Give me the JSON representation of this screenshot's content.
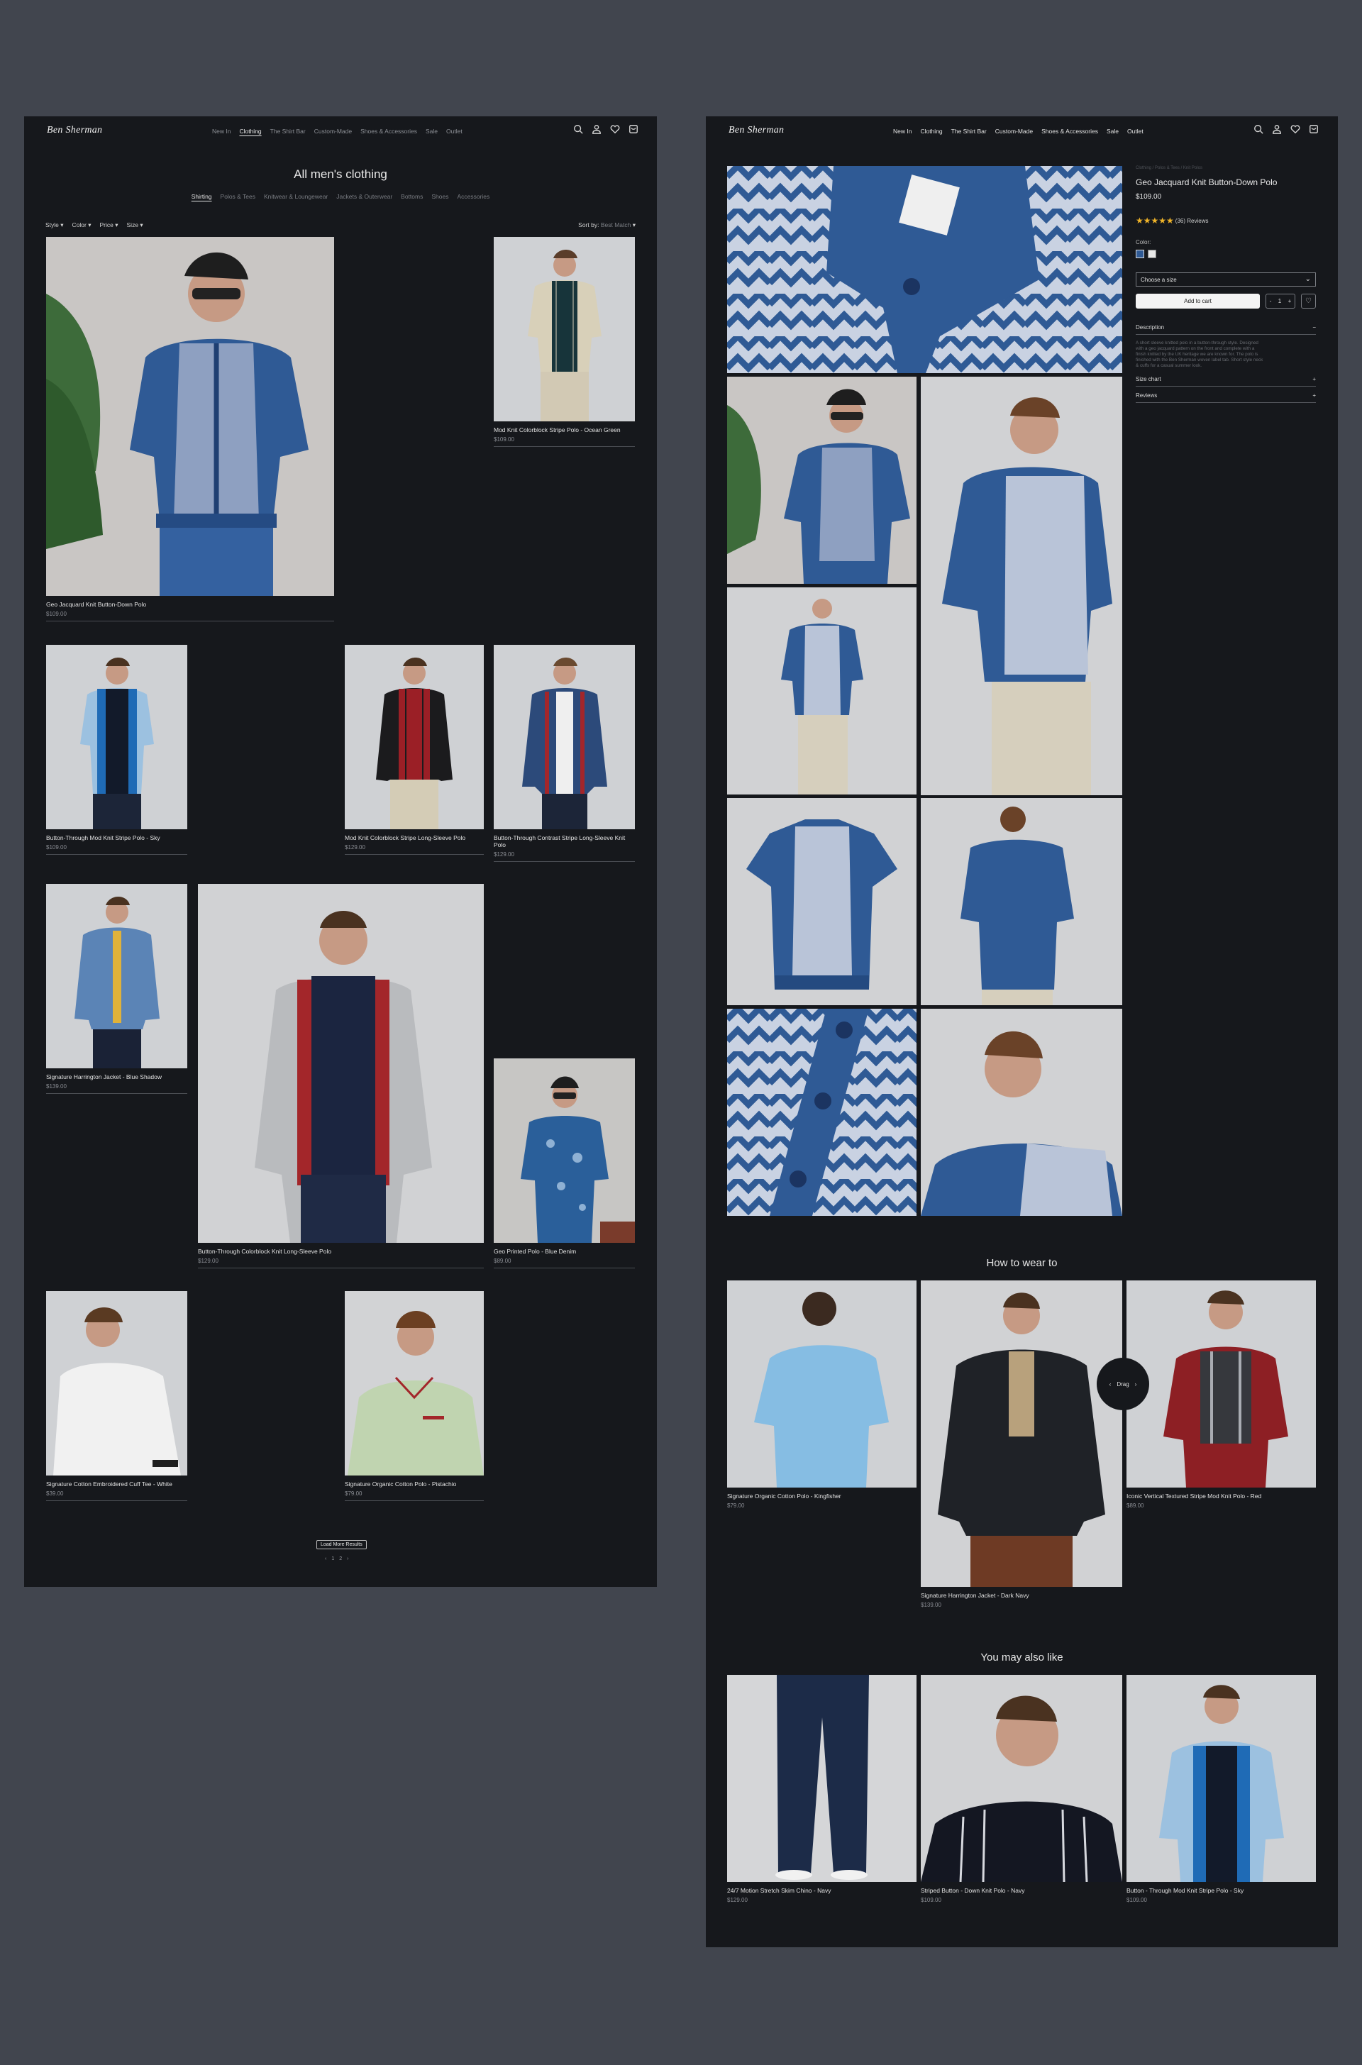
{
  "listing": {
    "logo": "Ben Sherman",
    "nav": [
      "New In",
      "Clothing",
      "The Shirt Bar",
      "Custom-Made",
      "Shoes & Accessories",
      "Sale",
      "Outlet"
    ],
    "title": "All men's clothing",
    "categories": [
      "Shirting",
      "Polos & Tees",
      "Knitwear & Loungewear",
      "Jackets & Outerwear",
      "Bottoms",
      "Shoes",
      "Accessories"
    ],
    "filters": [
      "Style",
      "Color",
      "Price",
      "Size"
    ],
    "sort_label": "Sort by:",
    "sort_value": "Best Match",
    "products": [
      {
        "name": "Geo Jacquard Knit Button-Down Polo",
        "price": "$109.00"
      },
      {
        "name": "Mod Knit Colorblock Stripe Polo - Ocean Green",
        "price": "$109.00"
      },
      {
        "name": "Button-Through Mod Knit Stripe Polo - Sky",
        "price": "$109.00"
      },
      {
        "name": "Mod Knit Colorblock Stripe Long-Sleeve Polo",
        "price": "$129.00"
      },
      {
        "name": "Button-Through Contrast Stripe Long-Sleeve Knit Polo",
        "price": "$129.00"
      },
      {
        "name": "Signature Harrington Jacket - Blue Shadow",
        "price": "$139.00"
      },
      {
        "name": "Button-Through Colorblock Knit Long-Sleeve Polo",
        "price": "$129.00"
      },
      {
        "name": "Geo Printed Polo - Blue Denim",
        "price": "$89.00"
      },
      {
        "name": "Signature Cotton Embroidered Cuff Tee - White",
        "price": "$39.00"
      },
      {
        "name": "Signature Organic Cotton Polo - Pistachio",
        "price": "$79.00"
      }
    ],
    "load_more": "Load More Results",
    "pager": [
      "‹",
      "1",
      "2",
      "›"
    ]
  },
  "detail": {
    "breadcrumb": "Clothing / Polos & Tees / Knit Polos",
    "name": "Geo Jacquard Knit Button-Down Polo",
    "price": "$109.00",
    "stars": "★★★★★",
    "reviews": "(36) Reviews",
    "color_label": "Color:",
    "size_placeholder": "Choose a size",
    "add_to_cart": "Add to cart",
    "qty_minus": "-",
    "qty": "1",
    "qty_plus": "+",
    "description_label": "Description",
    "description_text": "A short sleeve knitted polo in a button-through style. Designed with a geo jacquard pattern on the front and complete with a finish knitted by the UK heritage we are known for. The polo is finished with the Ben Sherman woven label tab. Short style neck & cuffs for a casual summer look.",
    "size_chart_label": "Size chart",
    "reviews_label": "Reviews",
    "how_to_wear_title": "How to wear to",
    "drag_label": "Drag",
    "how_to_wear": [
      {
        "name": "Signature Organic Cotton Polo - Kingfisher",
        "price": "$79.00"
      },
      {
        "name": "Signature Harrington Jacket - Dark Navy",
        "price": "$139.00"
      },
      {
        "name": "Iconic Vertical Textured Stripe Mod Knit Polo - Red",
        "price": "$89.00"
      }
    ],
    "also_like_title": "You may also like",
    "also_like": [
      {
        "name": "24/7 Motion Stretch Skim Chino - Navy",
        "price": "$129.00"
      },
      {
        "name": "Striped Button - Down Knit Polo - Navy",
        "price": "$109.00"
      },
      {
        "name": "Button - Through Mod Knit Stripe Polo - Sky",
        "price": "$109.00"
      }
    ]
  },
  "colors": {
    "panel_bg": "#16181c",
    "page_bg": "#41454e",
    "photo_bg": "#cfd1d4",
    "knit_blue": "#2f5a95",
    "star": "#f0b429"
  }
}
